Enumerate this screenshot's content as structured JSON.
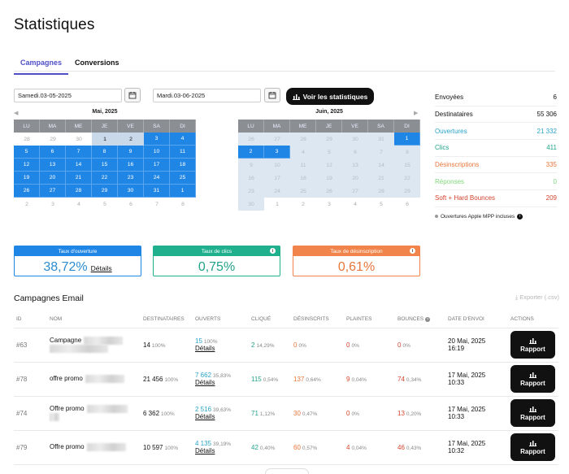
{
  "header": {
    "title": "Statistiques"
  },
  "tabs": [
    {
      "label": "Campagnes"
    },
    {
      "label": "Conversions"
    }
  ],
  "filters": {
    "start_date": "Samedi.03-05-2025",
    "end_date": "Mardi.03-06-2025",
    "view_stats_label": "Voir les statistiques"
  },
  "calendars": {
    "weekdays": [
      "LU",
      "MA",
      "ME",
      "JE",
      "VE",
      "SA",
      "DI"
    ],
    "may": {
      "title": "Mai, 2025",
      "prev": "◀",
      "days": [
        "28",
        "29",
        "30",
        "1",
        "2",
        "3",
        "4",
        "5",
        "6",
        "7",
        "8",
        "9",
        "10",
        "11",
        "12",
        "13",
        "14",
        "15",
        "16",
        "17",
        "18",
        "19",
        "20",
        "21",
        "22",
        "23",
        "24",
        "25",
        "26",
        "27",
        "28",
        "29",
        "30",
        "31",
        "1",
        "2",
        "3",
        "4",
        "5",
        "6",
        "7",
        "8"
      ]
    },
    "june": {
      "title": "Juin, 2025",
      "next": "▶",
      "days": [
        "26",
        "27",
        "28",
        "29",
        "30",
        "31",
        "1",
        "2",
        "3",
        "4",
        "5",
        "6",
        "7",
        "8",
        "9",
        "10",
        "11",
        "12",
        "13",
        "14",
        "15",
        "16",
        "17",
        "18",
        "19",
        "20",
        "21",
        "22",
        "23",
        "24",
        "25",
        "26",
        "27",
        "28",
        "29",
        "30",
        "1",
        "2",
        "3",
        "4",
        "5",
        "6"
      ]
    }
  },
  "summary": {
    "rows": [
      {
        "label": "Envoyées",
        "value": "6",
        "color": "#111111"
      },
      {
        "label": "Destinataires",
        "value": "55 306",
        "color": "#111111"
      },
      {
        "label": "Ouvertures",
        "value": "21 332",
        "color": "#2aa3c9"
      },
      {
        "label": "Clics",
        "value": "411",
        "color": "#21a38a"
      },
      {
        "label": "Désinscriptions",
        "value": "335",
        "color": "#e8763a"
      },
      {
        "label": "Réponses",
        "value": "0",
        "color": "#7fd87a"
      },
      {
        "label": "Soft + Hard Bounces",
        "value": "209",
        "color": "#d4442e"
      }
    ],
    "note": "Ouvertures Apple MPP incluses"
  },
  "kpis": [
    {
      "label": "Taux d'ouverture",
      "value": "38,72%",
      "details": "Détails",
      "color": "#1f86e6",
      "text_color": "#2a8ccf"
    },
    {
      "label": "Taux de clics",
      "value": "0,75%",
      "color": "#21b08e",
      "text_color": "#21a38a"
    },
    {
      "label": "Taux de désinscription",
      "value": "0,61%",
      "color": "#f0844a",
      "text_color": "#e8763a"
    }
  ],
  "campaigns": {
    "title": "Campagnes Email",
    "export_label": "Exporter (.csv)",
    "columns": [
      "ID",
      "NOM",
      "DESTINATAIRES",
      "OUVERTS",
      "CLIQUÉ",
      "DÉSINSCRITS",
      "PLAINTES",
      "BOUNCES",
      "DATE D'ENVOI",
      "ACTIONS"
    ],
    "rows": [
      {
        "id": "#63",
        "name": "Campagne",
        "recipients": "14",
        "recipients_pct": "100%",
        "opens": "15",
        "opens_pct": "100%",
        "details": "Détails",
        "clicks": "2",
        "clicks_pct": "14,29%",
        "unsubs": "0",
        "unsubs_pct": "0%",
        "complaints": "0",
        "complaints_pct": "0%",
        "bounces": "0",
        "bounces_pct": "0%",
        "date": "20 Mai, 2025",
        "time": "16:19",
        "action": "Rapport"
      },
      {
        "id": "#78",
        "name": "offre promo",
        "recipients": "21 456",
        "recipients_pct": "100%",
        "opens": "7 662",
        "opens_pct": "35,83%",
        "details": "Détails",
        "clicks": "115",
        "clicks_pct": "0,54%",
        "unsubs": "137",
        "unsubs_pct": "0,64%",
        "complaints": "9",
        "complaints_pct": "0,04%",
        "bounces": "74",
        "bounces_pct": "0,34%",
        "date": "17 Mai, 2025",
        "time": "10:33",
        "action": "Rapport"
      },
      {
        "id": "#74",
        "name": "Offre promo",
        "recipients": "6 362",
        "recipients_pct": "100%",
        "opens": "2 516",
        "opens_pct": "39,63%",
        "details": "Détails",
        "clicks": "71",
        "clicks_pct": "1,12%",
        "unsubs": "30",
        "unsubs_pct": "0,47%",
        "complaints": "0",
        "complaints_pct": "0%",
        "bounces": "13",
        "bounces_pct": "0,20%",
        "date": "17 Mai, 2025",
        "time": "10:33",
        "action": "Rapport"
      },
      {
        "id": "#79",
        "name": "Offre promo",
        "recipients": "10 597",
        "recipients_pct": "100%",
        "opens": "4 135",
        "opens_pct": "39,19%",
        "details": "Détails",
        "clicks": "42",
        "clicks_pct": "0,40%",
        "unsubs": "60",
        "unsubs_pct": "0,57%",
        "complaints": "4",
        "complaints_pct": "0,04%",
        "bounces": "46",
        "bounces_pct": "0,43%",
        "date": "17 Mai, 2025",
        "time": "10:32",
        "action": "Rapport"
      }
    ]
  }
}
